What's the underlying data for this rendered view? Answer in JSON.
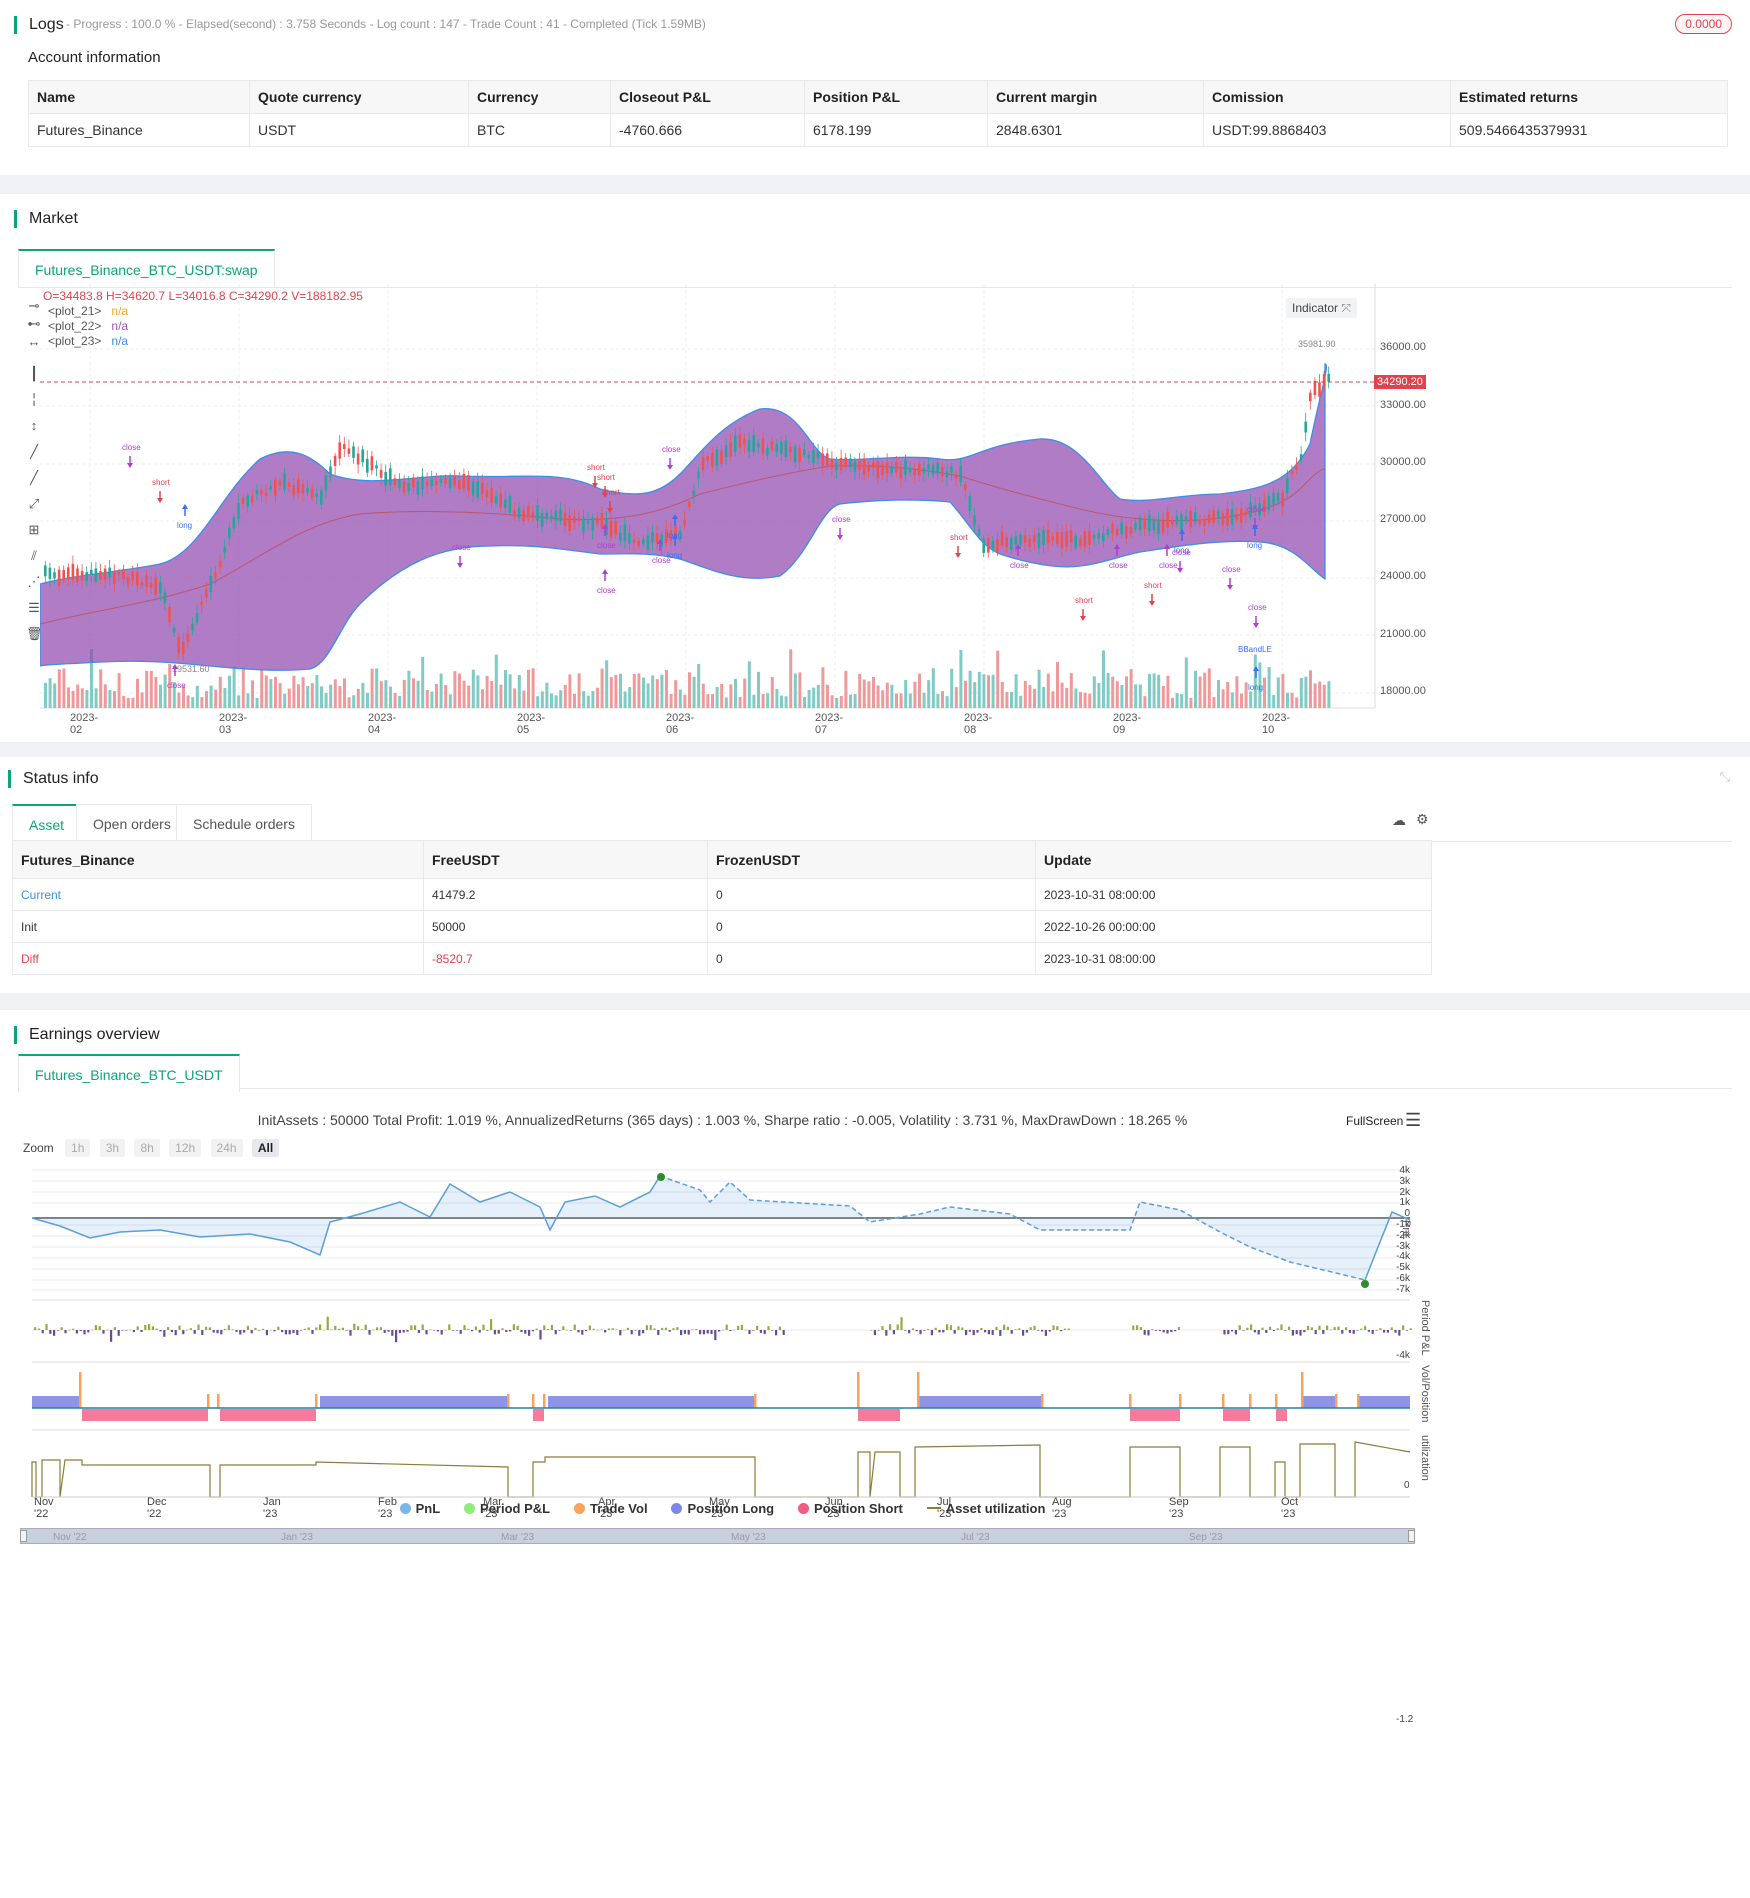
{
  "logs": {
    "title": "Logs",
    "status": "- Progress : 100.0 % - Elapsed(second) : 3.758  Seconds - Log count : 147 - Trade Count : 41 - Completed (Tick 1.59MB)",
    "badge": "0.0000"
  },
  "account": {
    "title": "Account information",
    "columns": [
      "Name",
      "Quote currency",
      "Currency",
      "Closeout P&L",
      "Position P&L",
      "Current margin",
      "Comission",
      "Estimated returns"
    ],
    "row": [
      "Futures_Binance",
      "USDT",
      "BTC",
      "-4760.666",
      "6178.199",
      "2848.6301",
      "USDT:99.8868403",
      "509.5466435379931"
    ]
  },
  "market": {
    "title": "Market",
    "tab": "Futures_Binance_BTC_USDT:swap",
    "ohlc": "O=34483.8 H=34620.7 L=34016.8 C=34290.2 V=188182.95",
    "plots": [
      {
        "name": "<plot_21>",
        "value": "n/a",
        "color": "#f5a623"
      },
      {
        "name": "<plot_22>",
        "value": "n/a",
        "color": "#9b59b6"
      },
      {
        "name": "<plot_23>",
        "value": "n/a",
        "color": "#3b8fe6"
      }
    ],
    "indicator_btn": "Indicator",
    "price_labels": [
      "36000.00",
      "33000.00",
      "30000.00",
      "27000.00",
      "24000.00",
      "21000.00",
      "18000.00"
    ],
    "current_price": "34290.20",
    "high_marker": "35981.90",
    "low_marker": "19531.60",
    "x_labels": [
      "2023-02",
      "2023-03",
      "2023-04",
      "2023-05",
      "2023-06",
      "2023-07",
      "2023-08",
      "2023-09",
      "2023-10"
    ],
    "signals": {
      "close": "close",
      "short": "short",
      "long": "long",
      "bband": "BBandLE"
    }
  },
  "status": {
    "title": "Status info",
    "tabs": [
      "Asset",
      "Open orders",
      "Schedule orders"
    ],
    "columns": [
      "Futures_Binance",
      "FreeUSDT",
      "FrozenUSDT",
      "Update"
    ],
    "rows": [
      [
        "Current",
        "41479.2",
        "0",
        "2023-10-31 08:00:00"
      ],
      [
        "Init",
        "50000",
        "0",
        "2022-10-26 00:00:00"
      ],
      [
        "Diff",
        "-8520.7",
        "0",
        "2023-10-31 08:00:00"
      ]
    ]
  },
  "earnings": {
    "title": "Earnings overview",
    "tab": "Futures_Binance_BTC_USDT",
    "summary": "InitAssets : 50000 Total Profit: 1.019 %, AnnualizedReturns (365 days) : 1.003 %, Sharpe ratio : -0.005, Volatility : 3.731 %, MaxDrawDown : 18.265 %",
    "fullscreen": "FullScreen",
    "zoom_label": "Zoom",
    "zoom_opts": [
      "1h",
      "3h",
      "8h",
      "12h",
      "24h",
      "All"
    ],
    "pnl_axis": [
      "4k",
      "3k",
      "2k",
      "1k",
      "0",
      "-1k",
      "-2k",
      "-3k",
      "-4k",
      "-5k",
      "-6k",
      "-7k"
    ],
    "period_axis": "-4k",
    "vol_axis": "-1.2",
    "util_axis": "0",
    "axis_titles": [
      "PnL",
      "Period P&L",
      "Vol/Position",
      "utilization"
    ],
    "x_labels": [
      "Nov '22",
      "Dec '22",
      "Jan '23",
      "Feb '23",
      "Mar '23",
      "Apr '23",
      "May '23",
      "Jun '23",
      "Jul '23",
      "Aug '23",
      "Sep '23",
      "Oct '23"
    ],
    "nav_labels": [
      "Nov '22",
      "Jan '23",
      "Mar '23",
      "May '23",
      "Jul '23",
      "Sep '23"
    ],
    "legend": [
      {
        "label": "PnL",
        "color": "#7cb5ec"
      },
      {
        "label": "Period P&L",
        "color": "#90ed7d"
      },
      {
        "label": "Trade Vol",
        "color": "#f7a35c"
      },
      {
        "label": "Position Long",
        "color": "#8085e9"
      },
      {
        "label": "Position Short",
        "color": "#f15c80"
      },
      {
        "label": "Asset utilization",
        "color": "#8d7b3a"
      }
    ]
  }
}
